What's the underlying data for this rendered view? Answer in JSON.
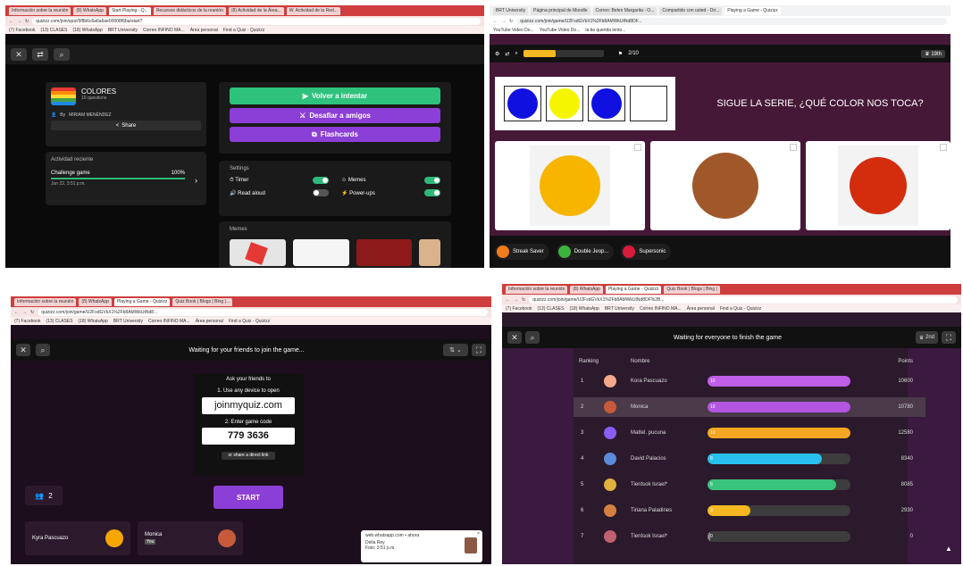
{
  "panel1": {
    "tabs": [
      "Información sobre la reunión",
      "(8) WhatsApp",
      "Start Playing - Q...",
      "Recursos didácticos de la reunión",
      "(8) Actividad de la Área...",
      "W. Actividad de la Red..."
    ],
    "url": "quizizz.com/join/quiz/5f8b6c6a6a6ae00008f6ba/start?",
    "bookmarks": [
      "(7) Facebook",
      "(13) CLASES",
      "(18) WhatsApp",
      "BRT University",
      "Correo INFINO MA...",
      "Área personal",
      "Find a Quiz - Quizizz"
    ],
    "quiz_title": "COLORES",
    "quiz_count": "10 questions",
    "by_label": "By",
    "author": "MIRIAM MENÉNDEZ",
    "share_label": "Share",
    "recent_title": "Actividad reciente",
    "recent_item": "Challenge game",
    "recent_pct": "100%",
    "recent_date": "Jun 22, 3:51 p.m.",
    "recent_progress": 1.0,
    "retry_label": "Volver a intentar",
    "challenge_label": "Desafiar a amigos",
    "flash_label": "Flashcards",
    "settings_title": "Settings",
    "settings": [
      {
        "label": "Timer",
        "on": true
      },
      {
        "label": "Memes",
        "on": true
      },
      {
        "label": "Read aloud",
        "on": false
      },
      {
        "label": "Power-ups",
        "on": true
      }
    ],
    "memes_title": "Memes"
  },
  "panel2": {
    "tabs": [
      "BRT University",
      "Página principal de Moodle",
      "Correo: Belen Margarita - O...",
      "Compartido con usted - Dri...",
      "Playing a Game - Quizizz"
    ],
    "url": "quizizz.com/join/game/U2FsdGVkX1%2Fb8AMWkUtNd8DF...",
    "bookmarks": [
      "YouTube Video Do...",
      "YouTube Video Do...",
      "la tia querida lento..."
    ],
    "counter": "2/10",
    "rank": "19th",
    "question": "SIGUE LA SERIE, ¿QUÉ COLOR NOS TOCA?",
    "series_colors": [
      "#1010e0",
      "#f5f500",
      "#1010e0",
      "#ffffff"
    ],
    "options": [
      "#f7b500",
      "#a0582a",
      "#d32d0e"
    ],
    "powerups": [
      {
        "label": "Streak Saver",
        "color": "#f07c1a"
      },
      {
        "label": "Double Jeop...",
        "color": "#3cb43c"
      },
      {
        "label": "Supersonic",
        "color": "#d81b3a"
      }
    ]
  },
  "panel3": {
    "tabs": [
      "Información sobre la reunión",
      "(8) WhatsApp",
      "Playing a Game - Quizizz",
      "Quiz Book | Blogs | Bing |..."
    ],
    "url": "quizizz.com/join/game/U2FsdGVkX1%2Fb8AMWkUtNd8...",
    "bookmarks": [
      "(7) Facebook",
      "(13) CLASES",
      "(18) WhatsApp",
      "BRT University",
      "Correo INFINO MA...",
      "Área personal",
      "Find a Quiz - Quizizz"
    ],
    "header": "Waiting for your friends to join the game...",
    "ask_label": "Ask your friends to",
    "step1": "1. Use any device to open",
    "join_url": "joinmyquiz.com",
    "step2": "2. Enter game code",
    "game_code": "779 3636",
    "share_link": "or share a direct link",
    "start_label": "START",
    "players_count": "2",
    "players": [
      {
        "name": "Kyra Pascuazo",
        "avatar": "#f7a600"
      },
      {
        "name": "Monica",
        "sub": "You",
        "avatar": "#c65a3a"
      }
    ],
    "notif_title": "web.whatsapp.com • ahora",
    "notif_sender": "Delia Rey",
    "notif_text": "Foto: 3:51 p.m."
  },
  "panel4": {
    "tabs": [
      "Información sobre la reunión",
      "(8) WhatsApp",
      "Playing a Game - Quizizz",
      "Quiz Book | Blogs | Bing |"
    ],
    "url": "quizizz.com/join/game/U2FsdGVkX1%2Fb8AMWkUtNd8DF%2B...",
    "bookmarks": [
      "(7) Facebook",
      "(13) CLASES",
      "(18) WhatsApp",
      "BRT University",
      "Correo INFINO MA...",
      "Área personal",
      "Find a Quiz - Quizizz"
    ],
    "header": "Waiting for everyone to finish the game",
    "rank_badge": "2nd",
    "col_ranking": "Ranking",
    "col_name": "Nombre",
    "col_points": "Points",
    "rows": [
      {
        "rank": "1",
        "name": "Kora Pascuazo",
        "correct": "10",
        "points": "10600",
        "progress": 1.0,
        "color": "#c05ee8",
        "avatar": "#f4a98b"
      },
      {
        "rank": "2",
        "name": "Monica",
        "correct": "10",
        "points": "10780",
        "progress": 1.0,
        "color": "#b355e0",
        "avatar": "#c65a3a"
      },
      {
        "rank": "3",
        "name": "Mattel. pucuna",
        "correct": "10",
        "points": "12580",
        "progress": 1.0,
        "color": "#f5a623",
        "avatar": "#8b5cf6"
      },
      {
        "rank": "4",
        "name": "David Palacios",
        "correct": "8",
        "points": "8340",
        "progress": 0.8,
        "color": "#29c0f0",
        "avatar": "#5b8bd9"
      },
      {
        "rank": "5",
        "name": "Tientsok Israel*",
        "correct": "8",
        "points": "8085",
        "progress": 0.9,
        "color": "#39c47b",
        "avatar": "#e0b040"
      },
      {
        "rank": "6",
        "name": "Tiriana Paladines",
        "correct": "3",
        "points": "2930",
        "progress": 0.3,
        "color": "#f5b820",
        "avatar": "#d48040"
      },
      {
        "rank": "7",
        "name": "Tientsok Israel*",
        "correct": "0",
        "points": "0",
        "progress": 0.0,
        "color": "#888888",
        "avatar": "#c06070"
      }
    ]
  }
}
